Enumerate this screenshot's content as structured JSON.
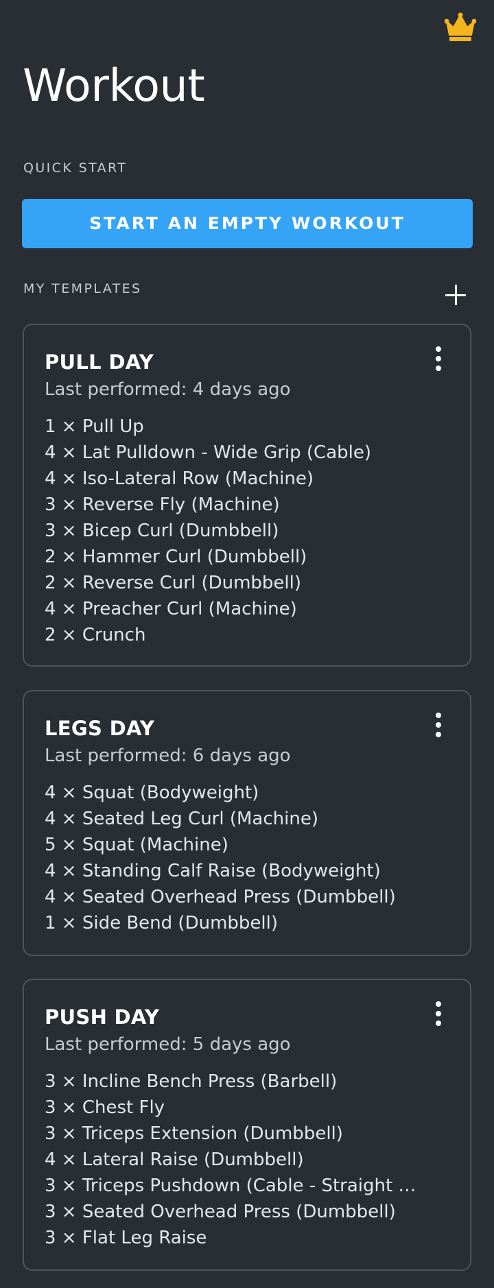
{
  "header": {
    "title": "Workout",
    "premium_icon": "crown-icon",
    "premium_color": "#f7b51d"
  },
  "quick_start": {
    "label": "QUICK START",
    "button_label": "START AN EMPTY WORKOUT",
    "button_color": "#35a4f7"
  },
  "templates": {
    "label": "MY TEMPLATES",
    "add_icon": "plus-icon",
    "items": [
      {
        "name": "PULL DAY",
        "last_performed": "Last performed: 4 days ago",
        "exercises": [
          "1 × Pull Up",
          "4 × Lat Pulldown - Wide Grip (Cable)",
          "4 × Iso-Lateral Row (Machine)",
          "3 × Reverse Fly (Machine)",
          "3 × Bicep Curl (Dumbbell)",
          "2 × Hammer Curl (Dumbbell)",
          "2 × Reverse Curl (Dumbbell)",
          "4 × Preacher Curl (Machine)",
          "2 × Crunch"
        ]
      },
      {
        "name": "LEGS DAY",
        "last_performed": "Last performed: 6 days ago",
        "exercises": [
          "4 × Squat (Bodyweight)",
          "4 × Seated Leg Curl (Machine)",
          "5 × Squat (Machine)",
          "4 × Standing Calf Raise (Bodyweight)",
          "4 × Seated Overhead Press (Dumbbell)",
          "1 × Side Bend (Dumbbell)"
        ]
      },
      {
        "name": "PUSH DAY",
        "last_performed": "Last performed: 5 days ago",
        "exercises": [
          "3 × Incline Bench Press (Barbell)",
          "3 × Chest Fly",
          "3 × Triceps Extension (Dumbbell)",
          "4 × Lateral Raise (Dumbbell)",
          "3 × Triceps Pushdown (Cable - Straight …",
          "3 × Seated Overhead Press (Dumbbell)",
          "3 × Flat Leg Raise"
        ]
      }
    ]
  },
  "colors": {
    "background": "#282e34",
    "card_border": "#4d555d",
    "accent": "#35a4f7"
  }
}
